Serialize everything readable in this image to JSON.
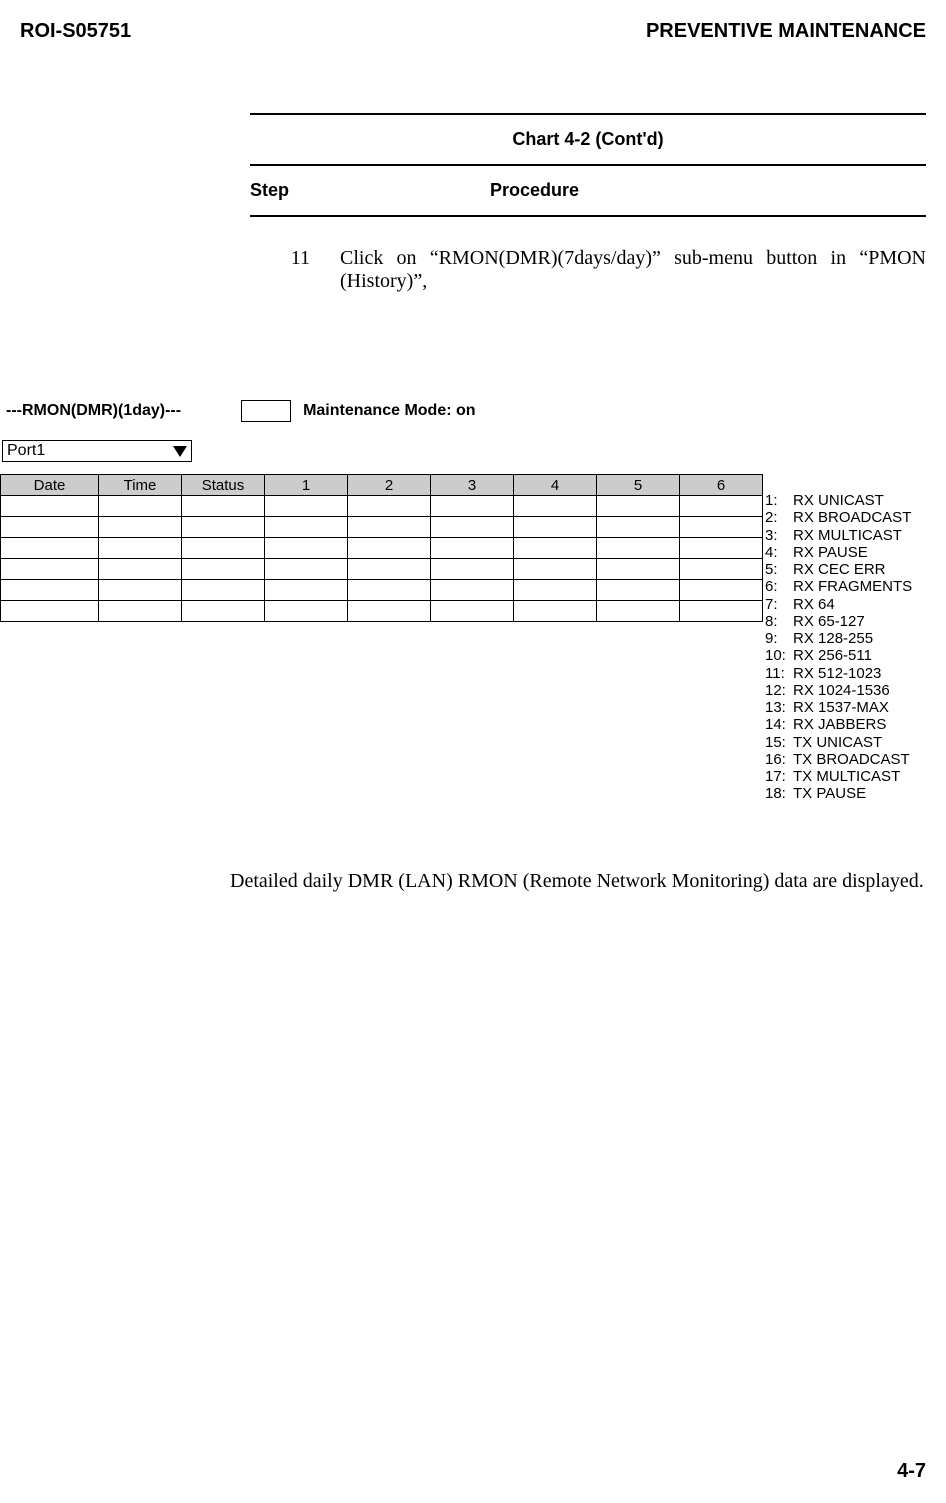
{
  "header": {
    "doc_id": "ROI-S05751",
    "section_title": "PREVENTIVE MAINTENANCE"
  },
  "chart": {
    "title": "Chart 4-2  (Cont'd)",
    "step_label": "Step",
    "procedure_label": "Procedure"
  },
  "step": {
    "number": "11",
    "text": "Click on “RMON(DMR)(7days/day)” sub-menu button in “PMON (History)”,"
  },
  "rmon": {
    "title": "---RMON(DMR)(1day)---",
    "maintenance_label": "Maintenance Mode: on",
    "port_selected": "Port1",
    "columns": [
      "Date",
      "Time",
      "Status",
      "1",
      "2",
      "3",
      "4",
      "5",
      "6"
    ],
    "row_count": 6,
    "legend": [
      {
        "n": "1:",
        "label": "RX UNICAST"
      },
      {
        "n": "2:",
        "label": "RX BROADCAST"
      },
      {
        "n": "3:",
        "label": "RX MULTICAST"
      },
      {
        "n": "4:",
        "label": "RX PAUSE"
      },
      {
        "n": "5:",
        "label": "RX CEC ERR"
      },
      {
        "n": "6:",
        "label": "RX FRAGMENTS"
      },
      {
        "n": "7:",
        "label": "RX 64"
      },
      {
        "n": "8:",
        "label": "RX 65-127"
      },
      {
        "n": "9:",
        "label": "RX 128-255"
      },
      {
        "n": "10:",
        "label": "RX 256-511"
      },
      {
        "n": "11:",
        "label": "RX 512-1023"
      },
      {
        "n": "12:",
        "label": "RX 1024-1536"
      },
      {
        "n": "13:",
        "label": "RX 1537-MAX"
      },
      {
        "n": "14:",
        "label": "RX JABBERS"
      },
      {
        "n": "15:",
        "label": "TX UNICAST"
      },
      {
        "n": "16:",
        "label": "TX BROADCAST"
      },
      {
        "n": "17:",
        "label": "TX MULTICAST"
      },
      {
        "n": "18:",
        "label": "TX PAUSE"
      }
    ]
  },
  "detail_text": "Detailed daily DMR (LAN) RMON (Remote Network Monitoring) data are displayed.",
  "page_number": "4-7"
}
